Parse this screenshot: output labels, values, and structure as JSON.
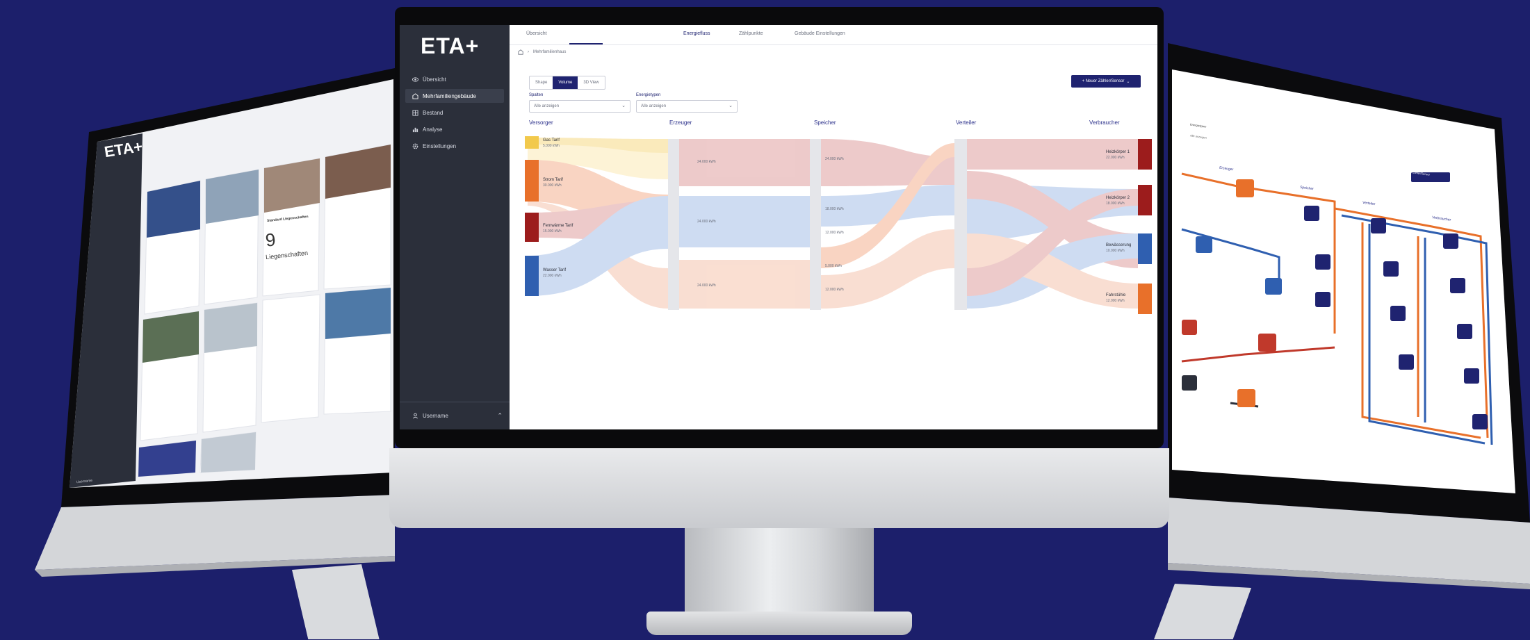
{
  "app": {
    "logo": "ETA+",
    "nav": [
      {
        "label": "Übersicht",
        "icon": "eye-icon"
      },
      {
        "label": "Mehrfamiliengebäude",
        "icon": "building-icon"
      },
      {
        "label": "Bestand",
        "icon": "grid-icon"
      },
      {
        "label": "Analyse",
        "icon": "chart-icon"
      },
      {
        "label": "Einstellungen",
        "icon": "gear-icon"
      }
    ],
    "active_nav": 1,
    "user": "Username",
    "tabs": [
      "Übersicht",
      "Energiefluss",
      "Zählpunkte",
      "Gebäude Einstellungen"
    ],
    "active_tab": 1,
    "breadcrumb": [
      "Mehrfamilienhaus"
    ],
    "view_toggle": [
      "Shape",
      "Volume",
      "3D View"
    ],
    "view_active": 1,
    "new_button": "+ Neuer Zähler/Sensor",
    "filters": {
      "columns_label": "Spalten",
      "columns_value": "Alle anzeigen",
      "types_label": "Energietypen",
      "types_value": "Alle anzeigen"
    }
  },
  "chart_data": {
    "type": "sankey",
    "columns": [
      "Versorger",
      "Erzeuger",
      "Speicher",
      "Verteiler",
      "Verbraucher"
    ],
    "sources": [
      {
        "name": "Gas Tarif",
        "value": "5.000 kWh",
        "color": "#f2c94c"
      },
      {
        "name": "Strom Tarif",
        "value": "30.000 kWh",
        "color": "#e8702a"
      },
      {
        "name": "Fernwärme Tarif",
        "value": "15.000 kWh",
        "color": "#9c1c1c"
      },
      {
        "name": "Wasser Tarif",
        "value": "22.000 kWh",
        "color": "#2f5fb0"
      }
    ],
    "producers": [
      "24.000 kWh",
      "24.000 kWh",
      "24.000 kWh"
    ],
    "storage": [
      "24.000 kWh",
      "18.000 kWh",
      "12.000 kWh",
      "5.000 kWh",
      "12.000 kWh"
    ],
    "consumers": [
      {
        "name": "Heizkörper 1",
        "value": "22.000 kWh",
        "color": "#9c1c1c"
      },
      {
        "name": "Heizkörper 2",
        "value": "18.000 kWh",
        "color": "#9c1c1c"
      },
      {
        "name": "Bewässerung",
        "value": "10.000 kWh",
        "color": "#2f5fb0"
      },
      {
        "name": "Fahrstühle",
        "value": "12.000 kWh",
        "color": "#e8702a"
      }
    ]
  },
  "left_screen": {
    "logo": "ETA+",
    "count": "9",
    "count_label": "Liegenschaften",
    "card_title": "Standard Liegenschaften",
    "user": "Username"
  },
  "right_screen": {
    "columns": [
      "Erzeuger",
      "Speicher",
      "Verteiler",
      "Verbraucher"
    ],
    "filter_label": "Energietypen",
    "filter_value": "Alle anzeigen",
    "button": "Zähler/Sensor"
  }
}
